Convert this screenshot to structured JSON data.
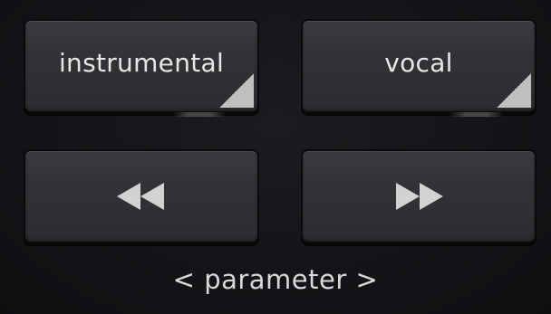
{
  "pads": {
    "instrumental": {
      "label": "instrumental"
    },
    "vocal": {
      "label": "vocal"
    },
    "rewind": {
      "icon": "rewind-icon"
    },
    "fast_forward": {
      "icon": "fast-forward-icon"
    }
  },
  "footer": {
    "label": "< parameter >"
  },
  "colors": {
    "background": "#131417",
    "pad": "#323336",
    "text": "#e6e6e6",
    "corner_marker": "#bfbfbf"
  }
}
